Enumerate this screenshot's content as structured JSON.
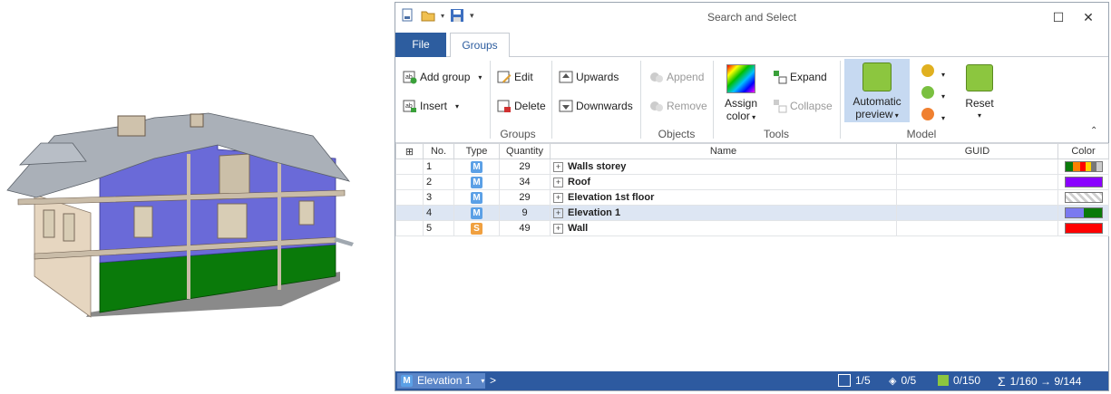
{
  "window": {
    "title": "Search and Select",
    "minimize_icon": "maximize-icon",
    "close_glyph": "✕",
    "maximize_glyph": "☐"
  },
  "tabs": {
    "file": "File",
    "groups": "Groups"
  },
  "ribbon": {
    "groups_panel": {
      "add_group": "Add group",
      "insert": "Insert",
      "edit": "Edit",
      "delete": "Delete",
      "upwards": "Upwards",
      "downwards": "Downwards",
      "label": "Groups"
    },
    "objects_panel": {
      "append": "Append",
      "remove": "Remove",
      "label": "Objects"
    },
    "tools_panel": {
      "assign_color_1": "Assign",
      "assign_color_2": "color",
      "expand": "Expand",
      "collapse": "Collapse",
      "label": "Tools"
    },
    "model_panel": {
      "auto_preview_1": "Automatic",
      "auto_preview_2": "preview",
      "reset": "Reset",
      "label": "Model"
    }
  },
  "table": {
    "headers": {
      "no": "No.",
      "type": "Type",
      "quantity": "Quantity",
      "name": "Name",
      "guid": "GUID",
      "color": "Color"
    },
    "rows": [
      {
        "no": "1",
        "type": "M",
        "quantity": "29",
        "name": "Walls storey",
        "guid": ""
      },
      {
        "no": "2",
        "type": "M",
        "quantity": "34",
        "name": "Roof",
        "guid": ""
      },
      {
        "no": "3",
        "type": "M",
        "quantity": "29",
        "name": "Elevation 1st floor",
        "guid": ""
      },
      {
        "no": "4",
        "type": "M",
        "quantity": "9",
        "name": "Elevation 1",
        "guid": ""
      },
      {
        "no": "5",
        "type": "S",
        "quantity": "49",
        "name": "Wall",
        "guid": ""
      }
    ],
    "type_colors": {
      "M": "#5ba0e6",
      "S": "#f0a040"
    }
  },
  "statusbar": {
    "selected_group_type": "M",
    "selected_group": "Elevation 1",
    "chevron": ">",
    "stat1": "1/5",
    "stat2": "0/5",
    "stat3": "0/150",
    "sigma": "Σ",
    "stat4": "1/160 → 9/144"
  },
  "colors": {
    "accent": "#2d5d9f",
    "wall_blue": "#6a6ad8",
    "wall_green": "#0a7a0a",
    "roof_purple": "#8a00ff",
    "wall_red": "#ff0000"
  }
}
